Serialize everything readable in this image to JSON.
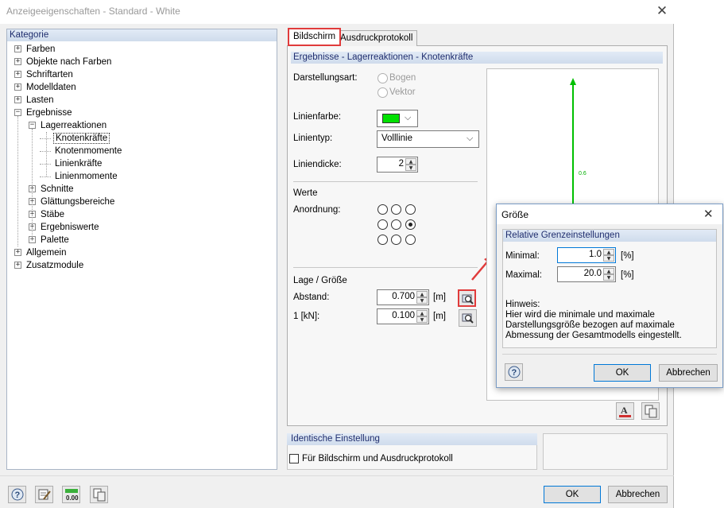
{
  "window": {
    "title": "Anzeigeeigenschaften - Standard - White",
    "close": "✕"
  },
  "tree": {
    "header": "Kategorie",
    "items": [
      {
        "label": "Farben",
        "expander": "+"
      },
      {
        "label": "Objekte nach Farben",
        "expander": "+"
      },
      {
        "label": "Schriftarten",
        "expander": "+"
      },
      {
        "label": "Modelldaten",
        "expander": "+"
      },
      {
        "label": "Lasten",
        "expander": "+"
      },
      {
        "label": "Ergebnisse",
        "expander": "−"
      },
      {
        "label": "Lagerreaktionen",
        "expander": "−"
      },
      {
        "label": "Knotenkräfte",
        "expander": ""
      },
      {
        "label": "Knotenmomente",
        "expander": ""
      },
      {
        "label": "Linienkräfte",
        "expander": ""
      },
      {
        "label": "Linienmomente",
        "expander": ""
      },
      {
        "label": "Schnitte",
        "expander": "+"
      },
      {
        "label": "Glättungsbereiche",
        "expander": "+"
      },
      {
        "label": "Stäbe",
        "expander": "+"
      },
      {
        "label": "Ergebniswerte",
        "expander": "+"
      },
      {
        "label": "Palette",
        "expander": "+"
      },
      {
        "label": "Allgemein",
        "expander": "+"
      },
      {
        "label": "Zusatzmodule",
        "expander": "+"
      }
    ]
  },
  "tabs": [
    {
      "label": "Bildschirm"
    },
    {
      "label": "Ausdruckprotokoll"
    }
  ],
  "panel": {
    "header": "Ergebnisse - Lagerreaktionen - Knotenkräfte",
    "darstellungsart_label": "Darstellungsart:",
    "radio_bogen": "Bogen",
    "radio_vektor": "Vektor",
    "linienfarbe_label": "Linienfarbe:",
    "linienfarbe_color": "#00e000",
    "linientyp_label": "Linientyp:",
    "linientyp_value": "Volllinie",
    "liniendicke_label": "Liniendicke:",
    "liniendicke_value": "2",
    "werte_label": "Werte",
    "anordnung_label": "Anordnung:",
    "lage_label": "Lage / Größe",
    "abstand_label": "Abstand:",
    "abstand_value": "0.700",
    "abstand_unit": "[m]",
    "scale_label": "1  [kN]:",
    "scale_value": "0.100",
    "scale_unit": "[m]",
    "arrow_value": "0.6",
    "arrow_color": "#00c000"
  },
  "identisch": {
    "header": "Identische Einstellung",
    "checkbox_label": "Für Bildschirm und Ausdruckprotokoll"
  },
  "footer": {
    "ok": "OK",
    "cancel": "Abbrechen"
  },
  "dialog": {
    "title": "Größe",
    "close": "✕",
    "group_header": "Relative Grenzeinstellungen",
    "minimal_label": "Minimal:",
    "minimal_value": "1.0",
    "minimal_unit": "[%]",
    "maximal_label": "Maximal:",
    "maximal_value": "20.0",
    "maximal_unit": "[%]",
    "hint_title": "Hinweis:",
    "hint_text": "Hier wird die minimale und maximale Darstellungsgröße bezogen auf maximale Abmessung der Gesamtmodells eingestellt.",
    "ok": "OK",
    "cancel": "Abbrechen"
  },
  "highlight_color": "#e03b3b"
}
